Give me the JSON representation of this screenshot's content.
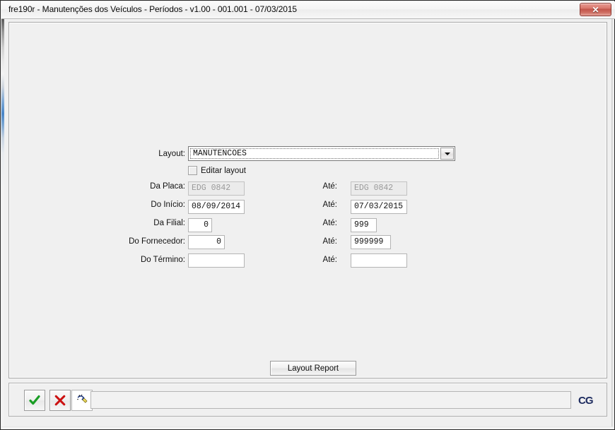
{
  "window": {
    "title": "fre190r - Manutenções dos Veículos - Períodos - v1.00 - 001.001 - 07/03/2015",
    "close_label": "✕"
  },
  "form": {
    "layout": {
      "label": "Layout:",
      "value": "MANUTENCOES",
      "dropdown_icon": "chevron-down-icon"
    },
    "edit_layout": {
      "label": "Editar layout",
      "checked": false
    },
    "rows": [
      {
        "label": "Da Placa:",
        "value": "EDG 0842",
        "disabled": true,
        "align": "left",
        "width": 80,
        "to_label": "Até:",
        "to_value": "EDG 0842",
        "to_disabled": true,
        "to_align": "left",
        "to_width": 80
      },
      {
        "label": "Do Início:",
        "value": "08/09/2014",
        "disabled": false,
        "align": "left",
        "width": 80,
        "to_label": "Até:",
        "to_value": "07/03/2015",
        "to_disabled": false,
        "to_align": "left",
        "to_width": 80
      },
      {
        "label": "Da Filial:",
        "value": "0",
        "disabled": false,
        "align": "right",
        "width": 34,
        "to_label": "Até:",
        "to_value": "999",
        "to_disabled": false,
        "to_align": "left",
        "to_width": 37
      },
      {
        "label": "Do Fornecedor:",
        "value": "0",
        "disabled": false,
        "align": "right",
        "width": 52,
        "to_label": "Até:",
        "to_value": "999999",
        "to_disabled": false,
        "to_align": "left",
        "to_width": 57
      },
      {
        "label": "Do Término:",
        "value": "",
        "disabled": false,
        "align": "left",
        "width": 80,
        "to_label": "Até:",
        "to_value": "",
        "to_disabled": false,
        "to_align": "left",
        "to_width": 80
      }
    ],
    "report_button": "Layout Report"
  },
  "toolbar": {
    "confirm_icon": "check-icon",
    "cancel_icon": "cross-icon",
    "wand_icon": "magic-wand-icon",
    "status_value": "",
    "logo": "CG"
  }
}
